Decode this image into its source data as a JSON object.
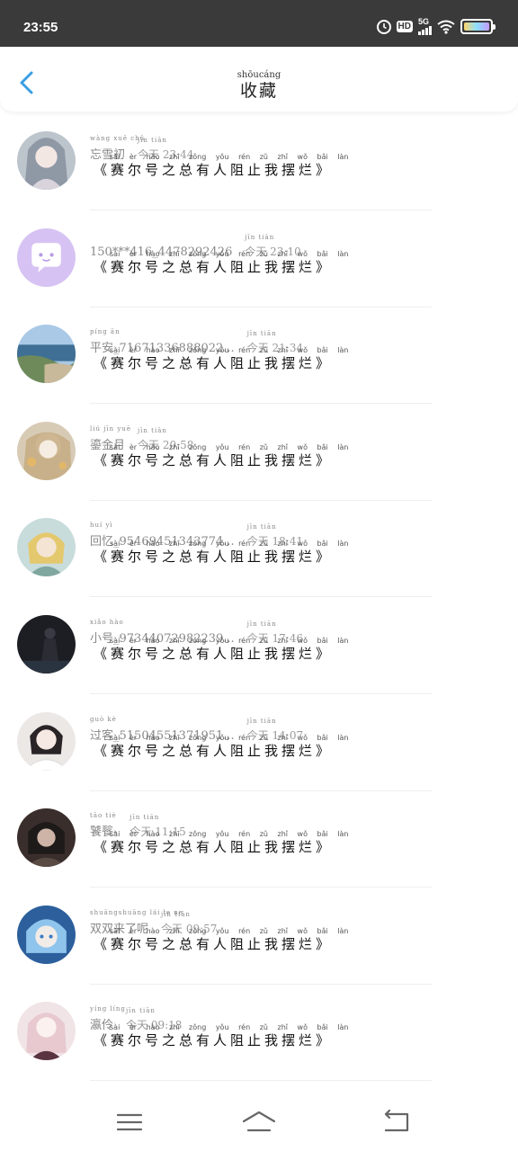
{
  "status": {
    "time": "23:55",
    "hd": "HD",
    "network": "5G"
  },
  "header": {
    "title": "收藏",
    "title_pinyin": "shōucáng"
  },
  "message_pinyin": "sài èr hào zhī zǒng yǒu rén zǔ zhǐ wǒ bǎi làn",
  "message": "《赛尔号之总有人阻止我摆烂》",
  "items": [
    {
      "name": "忘雪初",
      "name_pinyin": "wàng xuě chū",
      "time_pinyin": "jīn tiān",
      "time": "今天 23:44",
      "avatar": "avatar-anime-silver"
    },
    {
      "name": "150***416_4478292426",
      "name_pinyin": "",
      "time_pinyin": "jīn tiān",
      "time": "今天 23:10",
      "avatar": "avatar-default-chat"
    },
    {
      "name": "平安_71671336888022...",
      "name_pinyin": "píng ān",
      "time_pinyin": "jīn tiān",
      "time": "今天 21:34",
      "avatar": "avatar-seaside"
    },
    {
      "name": "鎏金月",
      "name_pinyin": "liú jīn yuè",
      "time_pinyin": "jīn tiān",
      "time": "今天 20:58",
      "avatar": "avatar-anime-gold"
    },
    {
      "name": "回忆_95469451343774...",
      "name_pinyin": "huí yì",
      "time_pinyin": "jīn tiān",
      "time": "今天 18:41",
      "avatar": "avatar-anime-blond"
    },
    {
      "name": "小号_97344072982239...",
      "name_pinyin": "xiǎo hào",
      "time_pinyin": "jīn tiān",
      "time": "今天 17:46",
      "avatar": "avatar-dark-figure"
    },
    {
      "name": "过客_51504551371951...",
      "name_pinyin": "guò kè",
      "time_pinyin": "jīn tiān",
      "time": "今天 14:07",
      "avatar": "avatar-anime-girl"
    },
    {
      "name": "饕餮-",
      "name_pinyin": "tāo tiè",
      "time_pinyin": "jīn tiān",
      "time": "今天 11:15",
      "avatar": "avatar-dark-anime"
    },
    {
      "name": "双双来了呢",
      "name_pinyin": "shuāngshuāng lái le ne",
      "time_pinyin": "jīn tiān",
      "time": "今天 09:57",
      "avatar": "avatar-anime-blue"
    },
    {
      "name": "瀛伶",
      "name_pinyin": "yíng líng",
      "time_pinyin": "jīn tiān",
      "time": "今天 09:18",
      "avatar": "avatar-anime-pink"
    }
  ],
  "colors": {
    "accent": "#3a9ee4",
    "statusbar": "#3a3a3a",
    "text_dark": "#111111",
    "text_muted": "#999999"
  },
  "nav": {
    "menu": "menu-icon",
    "home": "home-icon",
    "back": "back-icon"
  }
}
